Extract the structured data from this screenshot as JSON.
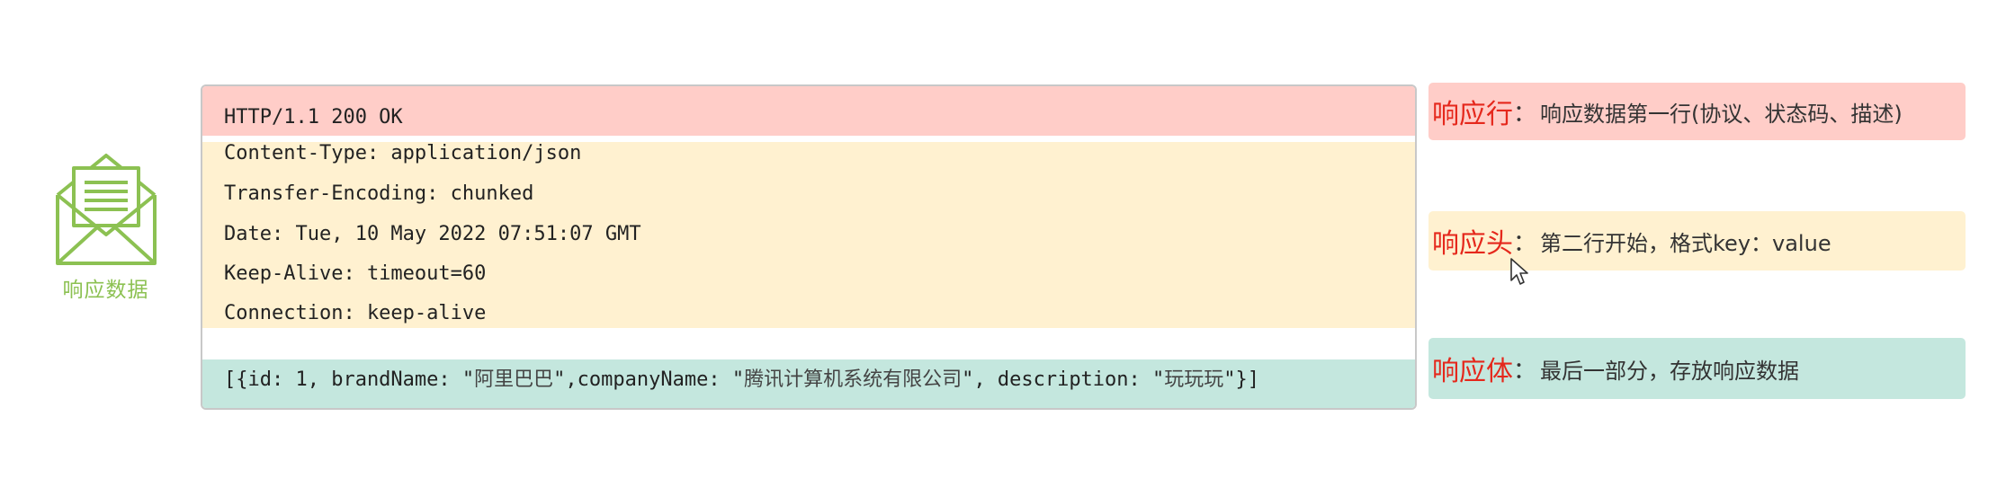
{
  "envelope": {
    "icon": "envelope-document-icon",
    "label": "响应数据",
    "color": "#8cc152"
  },
  "response": {
    "status_line": "HTTP/1.1 200 OK",
    "headers": [
      "Content-Type: application/json",
      "Transfer-Encoding: chunked",
      "Date: Tue, 10 May 2022 07:51:07 GMT",
      "Keep-Alive: timeout=60",
      "Connection: keep-alive"
    ],
    "body": {
      "p0": "[{id: 1, brandName: \"",
      "p1": "阿里巴巴",
      "p2": "\",companyName: \"",
      "p3": "腾讯计算机系统有限公司",
      "p4": "\", description: \"",
      "p5": "玩玩玩",
      "p6": "\"}]"
    },
    "colors": {
      "status": "#ffcdc8",
      "headers": "#fff1d0",
      "body": "#c4e7de"
    }
  },
  "annotations": [
    {
      "title": "响应行",
      "colon": "：",
      "description": "响应数据第一行(协议、状态码、描述)"
    },
    {
      "title": "响应头",
      "colon": "：",
      "description": "第二行开始，格式key：value"
    },
    {
      "title": "响应体",
      "colon": "：",
      "description": "最后一部分，存放响应数据"
    }
  ],
  "annotation_title_color": "#e5281c",
  "cursor": "mouse-pointer-icon"
}
